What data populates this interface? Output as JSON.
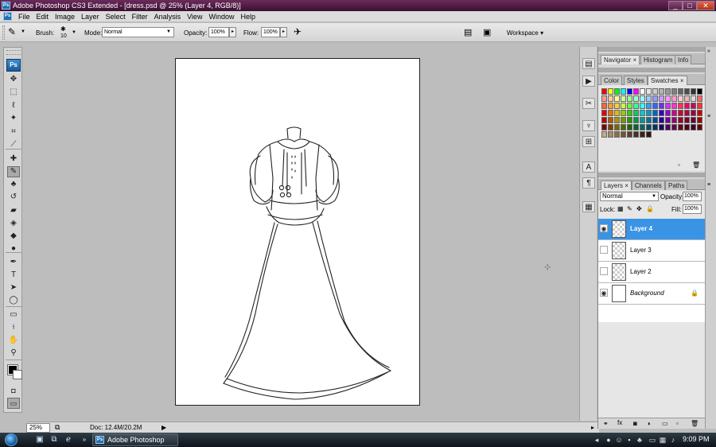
{
  "window": {
    "title": "Adobe Photoshop CS3 Extended - [dress.psd @ 25% (Layer 4, RGB/8)]",
    "app_icon_text": "Ps",
    "minimize": "_",
    "maximize": "□",
    "close": "✕"
  },
  "menu": [
    "File",
    "Edit",
    "Image",
    "Layer",
    "Select",
    "Filter",
    "Analysis",
    "View",
    "Window",
    "Help"
  ],
  "options": {
    "brush_label": "Brush:",
    "brush_size": "10",
    "mode_label": "Mode:",
    "mode_value": "Normal",
    "opacity_label": "Opacity:",
    "opacity_value": "100%",
    "flow_label": "Flow:",
    "flow_value": "100%",
    "workspace_label": "Workspace ▾"
  },
  "toolbox": {
    "logo": "Ps",
    "tools": [
      {
        "name": "move-tool-icon",
        "glyph": "✥"
      },
      {
        "name": "marquee-tool-icon",
        "glyph": "⬚"
      },
      {
        "name": "lasso-tool-icon",
        "glyph": "ℓ"
      },
      {
        "name": "magic-wand-tool-icon",
        "glyph": "✦"
      },
      {
        "name": "crop-tool-icon",
        "glyph": "⌗"
      },
      {
        "name": "slice-tool-icon",
        "glyph": "⟋"
      },
      {
        "name": "healing-brush-tool-icon",
        "glyph": "✚"
      },
      {
        "name": "brush-tool-icon",
        "glyph": "✎"
      },
      {
        "name": "clone-stamp-tool-icon",
        "glyph": "♣"
      },
      {
        "name": "history-brush-tool-icon",
        "glyph": "↺"
      },
      {
        "name": "eraser-tool-icon",
        "glyph": "▰"
      },
      {
        "name": "paint-bucket-tool-icon",
        "glyph": "◈"
      },
      {
        "name": "blur-tool-icon",
        "glyph": "◆"
      },
      {
        "name": "dodge-tool-icon",
        "glyph": "●"
      },
      {
        "name": "pen-tool-icon",
        "glyph": "✒"
      },
      {
        "name": "type-tool-icon",
        "glyph": "T"
      },
      {
        "name": "path-selection-tool-icon",
        "glyph": "➤"
      },
      {
        "name": "shape-tool-icon",
        "glyph": "◯"
      },
      {
        "name": "notes-tool-icon",
        "glyph": "▭"
      },
      {
        "name": "eyedropper-tool-icon",
        "glyph": "⟊"
      },
      {
        "name": "hand-tool-icon",
        "glyph": "✋"
      },
      {
        "name": "zoom-tool-icon",
        "glyph": "⚲"
      }
    ]
  },
  "status": {
    "zoom": "25%",
    "doc": "Doc: 12.4M/20.2M",
    "arrow": "▶"
  },
  "panels": {
    "nav_tabs": [
      "Navigator",
      "Histogram",
      "Info"
    ],
    "swatch_tabs": [
      "Color",
      "Styles",
      "Swatches"
    ],
    "layer_tabs": [
      "Layers",
      "Channels",
      "Paths"
    ],
    "close_mark": "×",
    "blend_mode": "Normal",
    "opacity_label": "Opacity:",
    "opacity_value": "100%",
    "lock_label": "Lock:",
    "fill_label": "Fill:",
    "fill_value": "100%",
    "layers": [
      {
        "name": "Layer 4",
        "visible": true,
        "selected": true
      },
      {
        "name": "Layer 3",
        "visible": false,
        "selected": false
      },
      {
        "name": "Layer 2",
        "visible": false,
        "selected": false
      },
      {
        "name": "Background",
        "visible": true,
        "selected": false,
        "locked": true
      }
    ],
    "swatch_colors": [
      [
        "#ff0000",
        "#ffff00",
        "#00ff00",
        "#00ffff",
        "#0000ff",
        "#ff00ff",
        "#ffffff",
        "#e6e6e6",
        "#cccccc",
        "#b3b3b3",
        "#999999",
        "#808080",
        "#666666",
        "#4d4d4d",
        "#333333",
        "#000000"
      ],
      [
        "#ff9a9a",
        "#ffcc99",
        "#ffff99",
        "#ccff99",
        "#99ff99",
        "#99ffcc",
        "#99ffff",
        "#99ccff",
        "#9999ff",
        "#cc99ff",
        "#ff99ff",
        "#ff99cc",
        "#ffcccc",
        "#e6b8b8",
        "#d9d9d9",
        "#ff6666"
      ],
      [
        "#ff6633",
        "#ff9933",
        "#ffcc33",
        "#ccff33",
        "#66ff33",
        "#33ff99",
        "#33ffff",
        "#3399ff",
        "#3366ff",
        "#6633ff",
        "#cc33ff",
        "#ff33cc",
        "#ff3366",
        "#ff0066",
        "#cc0066",
        "#ff3333"
      ],
      [
        "#e60000",
        "#e67300",
        "#e6b800",
        "#99cc00",
        "#33cc00",
        "#00cc66",
        "#00cccc",
        "#0099cc",
        "#0066cc",
        "#3300cc",
        "#9900cc",
        "#cc0099",
        "#cc0033",
        "#b3003b",
        "#99004d",
        "#cc0000"
      ],
      [
        "#b30000",
        "#b35900",
        "#b38f00",
        "#739900",
        "#269900",
        "#00994d",
        "#009999",
        "#007399",
        "#004d99",
        "#260099",
        "#730099",
        "#990073",
        "#990026",
        "#80002a",
        "#66003d",
        "#990000"
      ],
      [
        "#800000",
        "#804000",
        "#806600",
        "#4d6600",
        "#1a6600",
        "#006633",
        "#006666",
        "#004d66",
        "#003366",
        "#1a0066",
        "#4d0066",
        "#66004d",
        "#66001a",
        "#4d0019",
        "#400026",
        "#660000"
      ],
      [
        "#c8a882",
        "#a88a66",
        "#8c6e4e",
        "#735638",
        "#5c4028",
        "#4a3020",
        "#3a2418",
        "#2c1a10",
        "",
        "",
        "",
        "",
        "",
        "",
        "",
        ""
      ]
    ]
  },
  "taskbar": {
    "task_label": "Adobe Photoshop C...",
    "app_icon_text": "Ps",
    "clock": "9:09 PM"
  }
}
